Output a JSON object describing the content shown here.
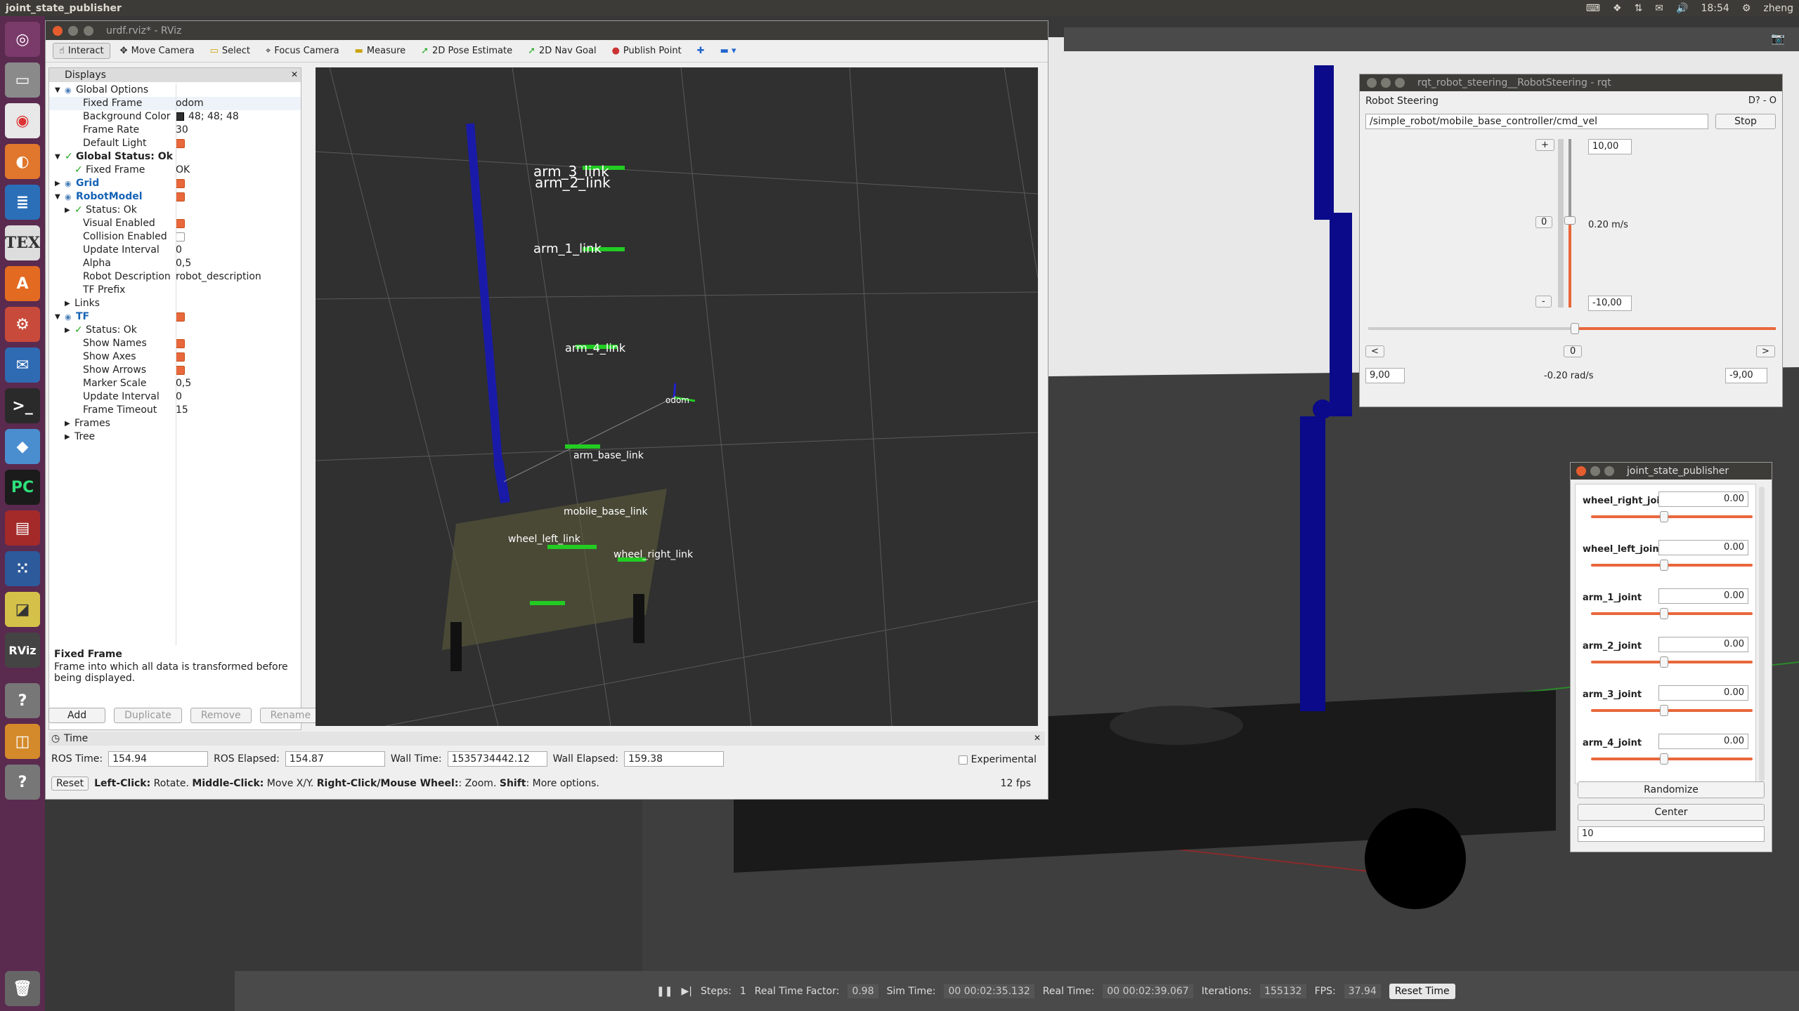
{
  "topbar": {
    "app_title": "joint_state_publisher",
    "clock": "18:54",
    "user": "zheng"
  },
  "launcher": {
    "items": [
      "ubuntu-dash",
      "files",
      "chrome",
      "firefox",
      "writer",
      "tex",
      "software-center",
      "settings",
      "thunderbird",
      "terminal",
      "virtualbox",
      "pycharm",
      "app-red",
      "apps-grid",
      "screen",
      "rviz",
      "unknown",
      "package",
      "unknown2",
      "trash"
    ]
  },
  "rviz": {
    "title": "urdf.rviz* - RViz",
    "tools": [
      "Interact",
      "Move Camera",
      "Select",
      "Focus Camera",
      "Measure",
      "2D Pose Estimate",
      "2D Nav Goal",
      "Publish Point"
    ],
    "displays_header": "Displays",
    "props": [
      {
        "k": "Global Options",
        "v": "",
        "indent": 1,
        "arrow": "▼",
        "bold": false
      },
      {
        "k": "Fixed Frame",
        "v": "odom",
        "indent": 2
      },
      {
        "k": "Background Color",
        "v": "48; 48; 48",
        "indent": 2,
        "swatch": "#303030"
      },
      {
        "k": "Frame Rate",
        "v": "30",
        "indent": 2
      },
      {
        "k": "Default Light",
        "v": "",
        "indent": 2,
        "check": true
      },
      {
        "k": "Global Status: Ok",
        "v": "",
        "indent": 1,
        "arrow": "▼",
        "tick": true
      },
      {
        "k": "Fixed Frame",
        "v": "OK",
        "indent": 2,
        "tick": true
      },
      {
        "k": "Grid",
        "v": "",
        "indent": 1,
        "arrow": "▶",
        "blue": true,
        "check": true
      },
      {
        "k": "RobotModel",
        "v": "",
        "indent": 1,
        "arrow": "▼",
        "blue": true,
        "check": true
      },
      {
        "k": "Status: Ok",
        "v": "",
        "indent": 2,
        "arrow": "▶",
        "tick": true
      },
      {
        "k": "Visual Enabled",
        "v": "",
        "indent": 2,
        "check": true
      },
      {
        "k": "Collision Enabled",
        "v": "",
        "indent": 2,
        "check": false
      },
      {
        "k": "Update Interval",
        "v": "0",
        "indent": 2
      },
      {
        "k": "Alpha",
        "v": "0,5",
        "indent": 2
      },
      {
        "k": "Robot Description",
        "v": "robot_description",
        "indent": 2
      },
      {
        "k": "TF Prefix",
        "v": "",
        "indent": 2
      },
      {
        "k": "Links",
        "v": "",
        "indent": 2,
        "arrow": "▶"
      },
      {
        "k": "TF",
        "v": "",
        "indent": 1,
        "arrow": "▼",
        "blue": true,
        "check": true
      },
      {
        "k": "Status: Ok",
        "v": "",
        "indent": 2,
        "arrow": "▶",
        "tick": true
      },
      {
        "k": "Show Names",
        "v": "",
        "indent": 2,
        "check": true
      },
      {
        "k": "Show Axes",
        "v": "",
        "indent": 2,
        "check": true
      },
      {
        "k": "Show Arrows",
        "v": "",
        "indent": 2,
        "check": true
      },
      {
        "k": "Marker Scale",
        "v": "0,5",
        "indent": 2
      },
      {
        "k": "Update Interval",
        "v": "0",
        "indent": 2
      },
      {
        "k": "Frame Timeout",
        "v": "15",
        "indent": 2
      },
      {
        "k": "Frames",
        "v": "",
        "indent": 2,
        "arrow": "▶"
      },
      {
        "k": "Tree",
        "v": "",
        "indent": 2,
        "arrow": "▶"
      }
    ],
    "desc_title": "Fixed Frame",
    "desc_text": "Frame into which all data is transformed before being displayed.",
    "buttons": {
      "add": "Add",
      "duplicate": "Duplicate",
      "remove": "Remove",
      "rename": "Rename"
    },
    "frame_labels": [
      "arm_3_link",
      "arm_2_link",
      "arm_1_link",
      "arm_4_link",
      "arm_base_link",
      "odom",
      "mobile_base_link",
      "wheel_left_link",
      "wheel_right_link"
    ],
    "time": {
      "header": "Time",
      "ros_time_label": "ROS Time:",
      "ros_time": "154.94",
      "ros_elapsed_label": "ROS Elapsed:",
      "ros_elapsed": "154.87",
      "wall_time_label": "Wall Time:",
      "wall_time": "1535734442.12",
      "wall_elapsed_label": "Wall Elapsed:",
      "wall_elapsed": "159.38",
      "experimental": "Experimental"
    },
    "reset": "Reset",
    "hint_parts": [
      "Left-Click:",
      " Rotate. ",
      "Middle-Click:",
      " Move X/Y. ",
      "Right-Click/Mouse Wheel:",
      ": Zoom. ",
      "Shift",
      ": More options."
    ],
    "fps": "12 fps"
  },
  "steer": {
    "title": "rqt_robot_steering__RobotSteering - rqt",
    "plugin": "Robot Steering",
    "topic": "/simple_robot/mobile_base_controller/cmd_vel",
    "stop": "Stop",
    "max_lin": "10,00",
    "min_lin": "-10,00",
    "lin_value": "0.20 m/s",
    "plus": "+",
    "minus": "-",
    "zero": "0",
    "left": "<",
    "right": ">",
    "max_ang": "9,00",
    "min_ang": "-9,00",
    "ang_value": "-0.20 rad/s"
  },
  "jsp": {
    "title": "joint_state_publisher",
    "joints": [
      {
        "name": "wheel_right_joint",
        "value": "0.00"
      },
      {
        "name": "wheel_left_joint",
        "value": "0.00"
      },
      {
        "name": "arm_1_joint",
        "value": "0.00"
      },
      {
        "name": "arm_2_joint",
        "value": "0.00"
      },
      {
        "name": "arm_3_joint",
        "value": "0.00"
      },
      {
        "name": "arm_4_joint",
        "value": "0.00"
      }
    ],
    "randomize": "Randomize",
    "center": "Center",
    "count": "10"
  },
  "gazebo": {
    "steps_label": "Steps:",
    "steps": "1",
    "rtf_label": "Real Time Factor:",
    "rtf": "0.98",
    "sim_label": "Sim Time:",
    "sim": "00 00:02:35.132",
    "real_label": "Real Time:",
    "real": "00 00:02:39.067",
    "iter_label": "Iterations:",
    "iter": "155132",
    "fps_label": "FPS:",
    "fps": "37.94",
    "reset": "Reset Time"
  }
}
